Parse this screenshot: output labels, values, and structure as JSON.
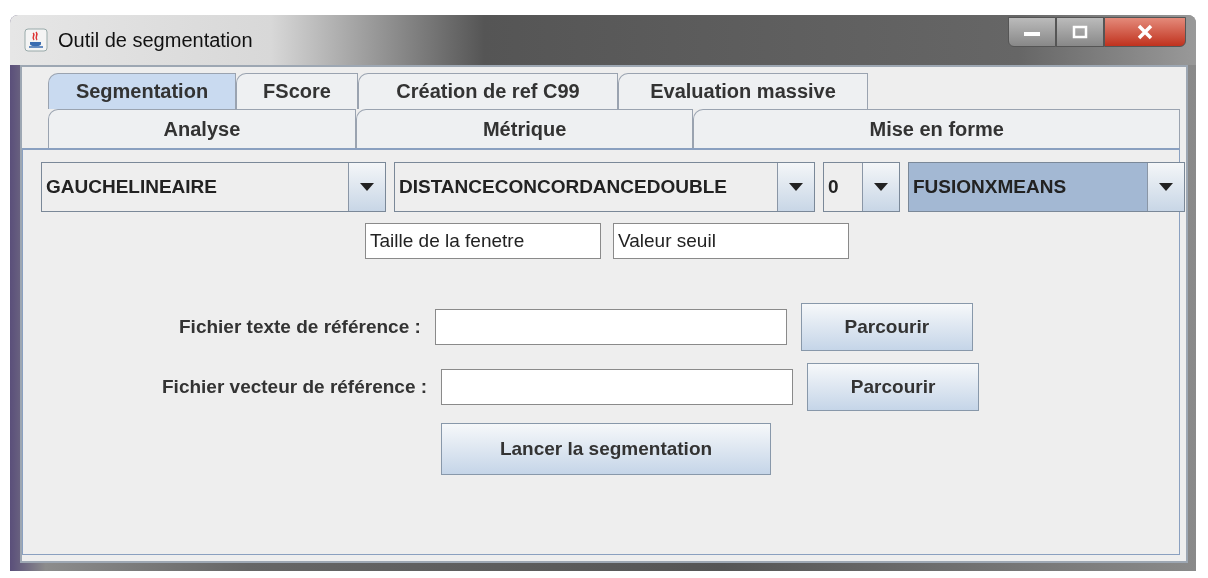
{
  "window": {
    "title": "Outil de segmentation"
  },
  "tab_rows": [
    [
      {
        "label": "Segmentation",
        "selected": true
      },
      {
        "label": "FScore",
        "selected": false
      },
      {
        "label": "Création de ref C99",
        "selected": false
      },
      {
        "label": "Evaluation massive",
        "selected": false
      }
    ],
    [
      {
        "label": "Analyse",
        "selected": false
      },
      {
        "label": "Métrique",
        "selected": false
      },
      {
        "label": "Mise en forme",
        "selected": false
      }
    ]
  ],
  "dropdowns": [
    {
      "value": "GAUCHELINEAIRE",
      "focused": false
    },
    {
      "value": "DISTANCECONCORDANCEDOUBLE",
      "focused": false
    },
    {
      "value": "0",
      "focused": false
    },
    {
      "value": "FUSIONXMEANS",
      "focused": true
    }
  ],
  "parameter_fields": [
    {
      "value": "Taille de la fenetre"
    },
    {
      "value": "Valeur seuil"
    }
  ],
  "file_rows": [
    {
      "label": "Fichier texte de référence :",
      "button": "Parcourir"
    },
    {
      "label": "Fichier vecteur de référence :",
      "button": "Parcourir"
    }
  ],
  "run_button": "Lancer la segmentation"
}
